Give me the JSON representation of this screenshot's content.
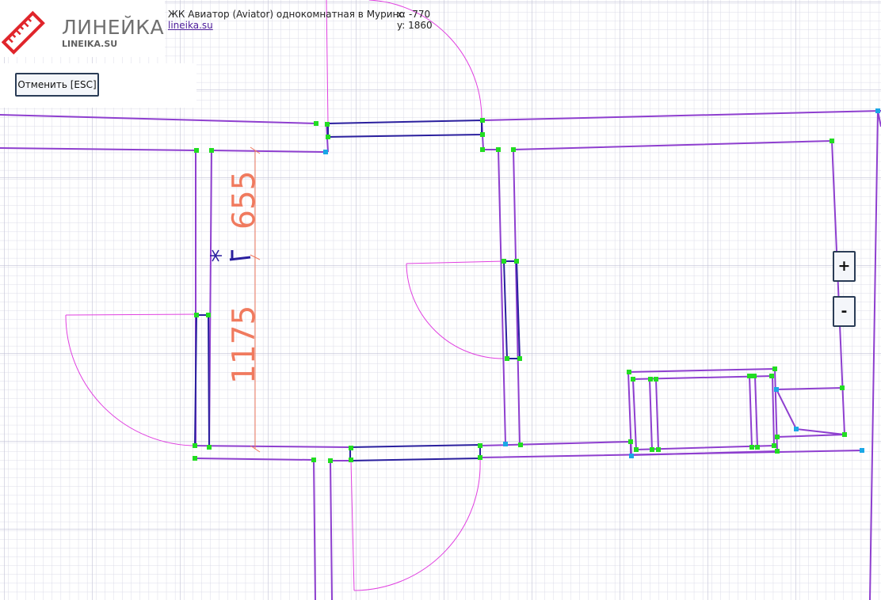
{
  "header": {
    "logo_name": "ЛИНЕЙКА",
    "logo_site": "LINEIKA.SU",
    "title": "ЖК Авиатор (Aviator) однокомнатная в Мурино",
    "link": "lineika.su"
  },
  "coords": {
    "x": "x: -770",
    "y": "y: 1860"
  },
  "toolbar": {
    "cancel_label": "Отменить [ESC]"
  },
  "zoom": {
    "in": "+",
    "out": "-"
  },
  "dimensions": {
    "upper": "655",
    "lower": "1175"
  },
  "colors": {
    "wall": "#8e3fcf",
    "window": "#2a1f9e",
    "door_arc": "#e040e0",
    "vertex": "#22dd22",
    "vertex_alt": "#1aa7e6",
    "dimension": "#f07a5e",
    "grid_minor": "#dcdce8",
    "grid_major": "#c2c2d6"
  }
}
